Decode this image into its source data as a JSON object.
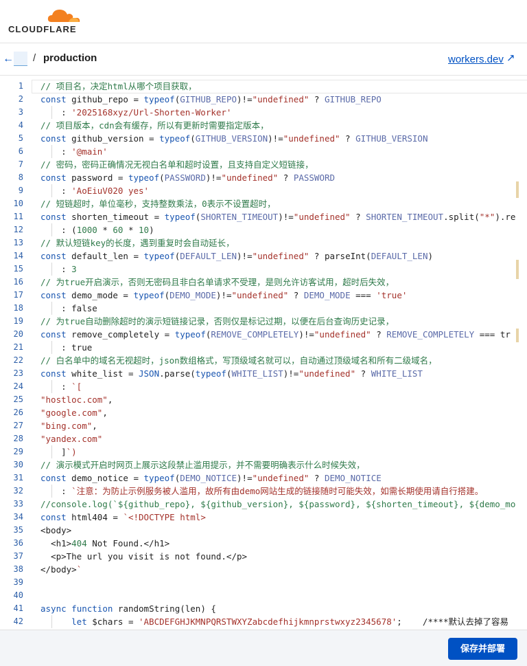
{
  "brand": {
    "logo_text": "CLOUDFLARE",
    "accent": "#f38020"
  },
  "breadcrumb": {
    "back_icon": "←",
    "separator": "/",
    "current": "production"
  },
  "workers_link": {
    "label": "workers.dev",
    "icon": "↗"
  },
  "deploy_button": {
    "label": "保存并部署"
  },
  "colors": {
    "primary": "#0051c3",
    "comment": "#2f7a4a",
    "keyword": "#1a56b0",
    "string": "#a4322b"
  },
  "code_lines": [
    {
      "n": "1",
      "t": "// 项目名，决定html从哪个项目获取，"
    },
    {
      "n": "2",
      "t": "const github_repo = typeof(GITHUB_REPO)!=\"undefined\" ? GITHUB_REPO"
    },
    {
      "n": "3",
      "t": "    : '2025168xyz/Url-Shorten-Worker'"
    },
    {
      "n": "4",
      "t": "// 项目版本，cdn会有缓存，所以有更新时需要指定版本，"
    },
    {
      "n": "5",
      "t": "const github_version = typeof(GITHUB_VERSION)!=\"undefined\" ? GITHUB_VERSION"
    },
    {
      "n": "6",
      "t": "    : '@main'"
    },
    {
      "n": "7",
      "t": "// 密码，密码正确情况无视白名单和超时设置，且支持自定义短链接，"
    },
    {
      "n": "8",
      "t": "const password = typeof(PASSWORD)!=\"undefined\" ? PASSWORD"
    },
    {
      "n": "9",
      "t": "    : 'AoEiuV020 yes'"
    },
    {
      "n": "10",
      "t": "// 短链超时，单位毫秒，支持整数乘法，0表示不设置超时，"
    },
    {
      "n": "11",
      "t": "const shorten_timeout = typeof(SHORTEN_TIMEOUT)!=\"undefined\" ? SHORTEN_TIMEOUT.split(\"*\").re"
    },
    {
      "n": "12",
      "t": "    : (1000 * 60 * 10)"
    },
    {
      "n": "13",
      "t": "// 默认短链key的长度，遇到重复时会自动延长，"
    },
    {
      "n": "14",
      "t": "const default_len = typeof(DEFAULT_LEN)!=\"undefined\" ? parseInt(DEFAULT_LEN)"
    },
    {
      "n": "15",
      "t": "    : 3"
    },
    {
      "n": "16",
      "t": "// 为true开启演示，否则无密码且非白名单请求不受理，是则允许访客试用，超时后失效，"
    },
    {
      "n": "17",
      "t": "const demo_mode = typeof(DEMO_MODE)!=\"undefined\" ? DEMO_MODE === 'true'"
    },
    {
      "n": "18",
      "t": "    : false"
    },
    {
      "n": "19",
      "t": "// 为true自动删除超时的演示短链接记录，否则仅是标记过期，以便在后台查询历史记录，"
    },
    {
      "n": "20",
      "t": "const remove_completely = typeof(REMOVE_COMPLETELY)!=\"undefined\" ? REMOVE_COMPLETELY === 'tr"
    },
    {
      "n": "21",
      "t": "    : true"
    },
    {
      "n": "22",
      "t": "// 白名单中的域名无视超时，json数组格式，写顶级域名就可以，自动通过顶级域名和所有二级域名，"
    },
    {
      "n": "23",
      "t": "const white_list = JSON.parse(typeof(WHITE_LIST)!=\"undefined\" ? WHITE_LIST"
    },
    {
      "n": "24",
      "t": "    : `["
    },
    {
      "n": "25",
      "t": "\"hostloc.com\","
    },
    {
      "n": "26",
      "t": "\"google.com\","
    },
    {
      "n": "27",
      "t": "\"bing.com\","
    },
    {
      "n": "28",
      "t": "\"yandex.com\""
    },
    {
      "n": "29",
      "t": "    ]`)"
    },
    {
      "n": "30",
      "t": "// 演示模式开启时网页上展示这段禁止滥用提示，并不需要明确表示什么时候失效，"
    },
    {
      "n": "31",
      "t": "const demo_notice = typeof(DEMO_NOTICE)!=\"undefined\" ? DEMO_NOTICE"
    },
    {
      "n": "32",
      "t": "    : `注意：为防止示例服务被人滥用，故所有由demo网站生成的链接随时可能失效，如需长期使用请自行搭建。"
    },
    {
      "n": "33",
      "t": "//console.log(`${github_repo}, ${github_version}, ${password}, ${shorten_timeout}, ${demo_mo"
    },
    {
      "n": "34",
      "t": "const html404 = `<!DOCTYPE html>"
    },
    {
      "n": "35",
      "t": "<body>"
    },
    {
      "n": "36",
      "t": "  <h1>404 Not Found.</h1>"
    },
    {
      "n": "37",
      "t": "  <p>The url you visit is not found.</p>"
    },
    {
      "n": "38",
      "t": "</body>`"
    },
    {
      "n": "39",
      "t": ""
    },
    {
      "n": "40",
      "t": ""
    },
    {
      "n": "41",
      "t": "async function randomString(len) {"
    },
    {
      "n": "42",
      "t": "      let $chars = 'ABCDEFGHJKMNPQRSTWXYZabcdefhijkmnprstwxyz2345678';    /****默认去掉了容易"
    }
  ]
}
